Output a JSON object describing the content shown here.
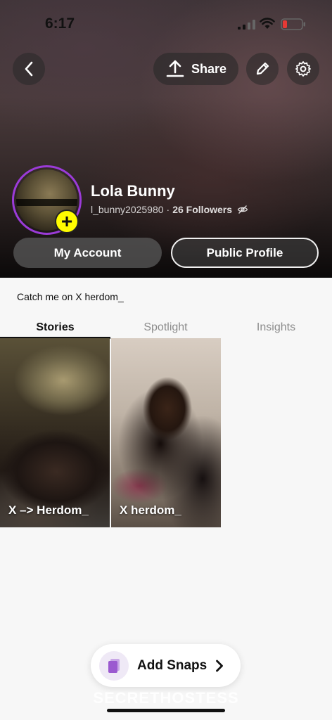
{
  "status_bar": {
    "time": "6:17"
  },
  "header": {
    "share_label": "Share",
    "display_name": "Lola Bunny",
    "username": "l_bunny2025980",
    "separator": "·",
    "followers": "26 Followers",
    "my_account_label": "My Account",
    "public_profile_label": "Public Profile",
    "add_badge": "+"
  },
  "bio": "Catch me on X herdom_",
  "tabs": [
    {
      "label": "Stories",
      "active": true
    },
    {
      "label": "Spotlight",
      "active": false
    },
    {
      "label": "Insights",
      "active": false
    }
  ],
  "stories": [
    {
      "label": "X –> Herdom_"
    },
    {
      "label": "X herdom_"
    }
  ],
  "add_snaps": {
    "label": "Add Snaps"
  },
  "watermark": "SECRETHOSTESS",
  "colors": {
    "avatar_ring": "#9b3bd8",
    "add_badge": "#fffc00",
    "snaps_icon": "#9b59d0"
  },
  "icons": [
    "back-icon",
    "share-upload-icon",
    "pencil-icon",
    "gear-icon",
    "eye-off-icon",
    "signal-icon",
    "wifi-icon",
    "battery-icon",
    "snaps-icon",
    "chevron-right-icon"
  ]
}
